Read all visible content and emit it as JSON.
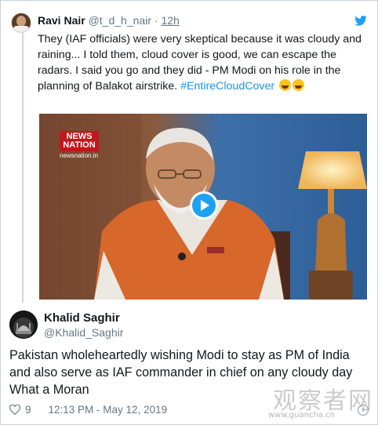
{
  "quoted_tweet": {
    "name": "Ravi Nair",
    "handle": "@t_d_h_nair",
    "separator": "·",
    "time": "12h",
    "text": "They (IAF officials) were very skeptical because it was cloudy and raining... I told them, cloud cover is good, we can escape the radars. I said you go and they did - PM Modi on his role in the planning of Balakot airstrike. ",
    "hashtag": "#EntireCloudCover",
    "video": {
      "channel_logo_line1": "NEWS",
      "channel_logo_line2": "NATION",
      "channel_url": "newsnation.in"
    }
  },
  "tweet": {
    "name": "Khalid Saghir",
    "handle": "@Khalid_Saghir",
    "text_lines": [
      "Pakistan wholeheartedly wishing Modi to stay as PM of India",
      "and also serve  as IAF commander in chief on any cloudy day",
      "What a Moran"
    ],
    "likes": "9",
    "timestamp": "12:13 PM - May 12, 2019",
    "info_icon": "i"
  },
  "watermark": {
    "text": "观察者网",
    "url": "www.guancha.cn"
  },
  "colors": {
    "link": "#1b95e0",
    "twitter_blue": "#1da1f2",
    "muted": "#657786"
  }
}
